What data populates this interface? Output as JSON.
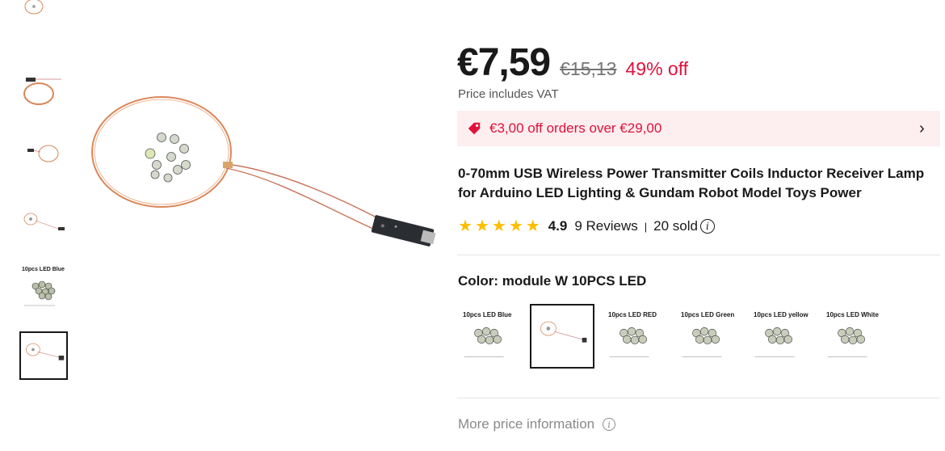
{
  "price": {
    "current": "€7,59",
    "original": "€15,13",
    "discount": "49% off",
    "vat_note": "Price includes VAT"
  },
  "coupon": {
    "icon": "tag-icon",
    "text": "€3,00 off orders over €29,00",
    "chevron": "›"
  },
  "title": "0-70mm USB Wireless Power Transmitter Coils Inductor Receiver Lamp for Arduino LED Lighting & Gundam Robot Model Toys Power",
  "rating": {
    "stars": 5,
    "value": "4.9",
    "reviews": "9 Reviews",
    "separator": "|",
    "sold": "20 sold",
    "info_glyph": "i"
  },
  "color": {
    "label": "Color: module W 10PCS LED",
    "options": [
      {
        "label": "10pcs LED Blue",
        "selected": false
      },
      {
        "label": "",
        "selected": true
      },
      {
        "label": "10pcs LED RED",
        "selected": false
      },
      {
        "label": "10pcs LED Green",
        "selected": false
      },
      {
        "label": "10pcs LED yellow",
        "selected": false
      },
      {
        "label": "10pcs LED White",
        "selected": false
      }
    ]
  },
  "thumbnails": [
    {
      "label": ""
    },
    {
      "label": ""
    },
    {
      "label": ""
    },
    {
      "label": ""
    },
    {
      "label": "10pcs LED Blue"
    },
    {
      "label": ""
    }
  ],
  "more_price": {
    "text": "More price information",
    "info_glyph": "i"
  },
  "colors": {
    "accent_red": "#e0113b",
    "coupon_bg": "#fdeeef",
    "star": "#fdbd00"
  }
}
